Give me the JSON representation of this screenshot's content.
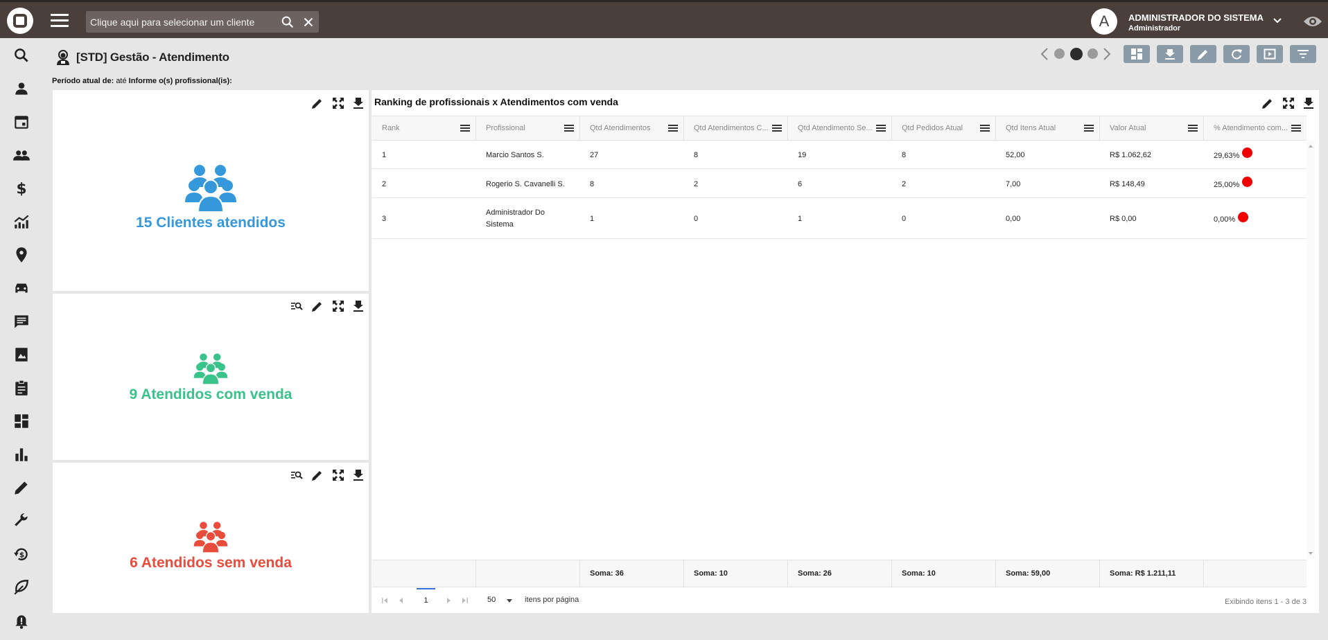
{
  "topbar": {
    "client_placeholder": "Clique aqui para selecionar um cliente",
    "avatar_letter": "A",
    "user_name": "ADMINISTRADOR DO SISTEMA",
    "user_role": "Administrador"
  },
  "page": {
    "title": "[STD] Gestão - Atendimento",
    "period_label": "Período atual de:",
    "period_value": "até",
    "professional_label": "Informe o(s) profissional(is):"
  },
  "kpis": [
    {
      "label": "15 Clientes atendidos",
      "color": "#3498db"
    },
    {
      "label": "9 Atendidos com venda",
      "color": "#39c28a"
    },
    {
      "label": "6 Atendidos sem venda",
      "color": "#e74c3c"
    }
  ],
  "grid": {
    "title": "Ranking de profissionais x Atendimentos com venda",
    "columns": [
      "Rank",
      "Profissional",
      "Qtd Atendimentos",
      "Qtd Atendimentos C...",
      "Qtd Atendimento Se...",
      "Qtd Pedidos Atual",
      "Qtd Itens Atual",
      "Valor Atual",
      "% Atendimento com..."
    ],
    "rows": [
      {
        "rank": "1",
        "name": "Marcio Santos S.",
        "qtd": "27",
        "com": "8",
        "sem": "19",
        "pedidos": "8",
        "itens": "52,00",
        "valor": "R$ 1.062,62",
        "pct": "29,63%"
      },
      {
        "rank": "2",
        "name": "Rogerio S. Cavanelli S.",
        "qtd": "8",
        "com": "2",
        "sem": "6",
        "pedidos": "2",
        "itens": "7,00",
        "valor": "R$ 148,49",
        "pct": "25,00%"
      },
      {
        "rank": "3",
        "name": "Administrador Do Sistema",
        "qtd": "1",
        "com": "0",
        "sem": "1",
        "pedidos": "0",
        "itens": "0,00",
        "valor": "R$ 0,00",
        "pct": "0,00%"
      }
    ],
    "totals": [
      "Soma: 36",
      "Soma: 10",
      "Soma: 26",
      "Soma: 10",
      "Soma: 59,00",
      "Soma: R$ 1.211,11"
    ],
    "page_number": "1",
    "page_size": "50",
    "page_size_label": "itens por página",
    "page_info": "Exibindo itens 1 - 3 de 3",
    "status_color": "#ee0000"
  }
}
